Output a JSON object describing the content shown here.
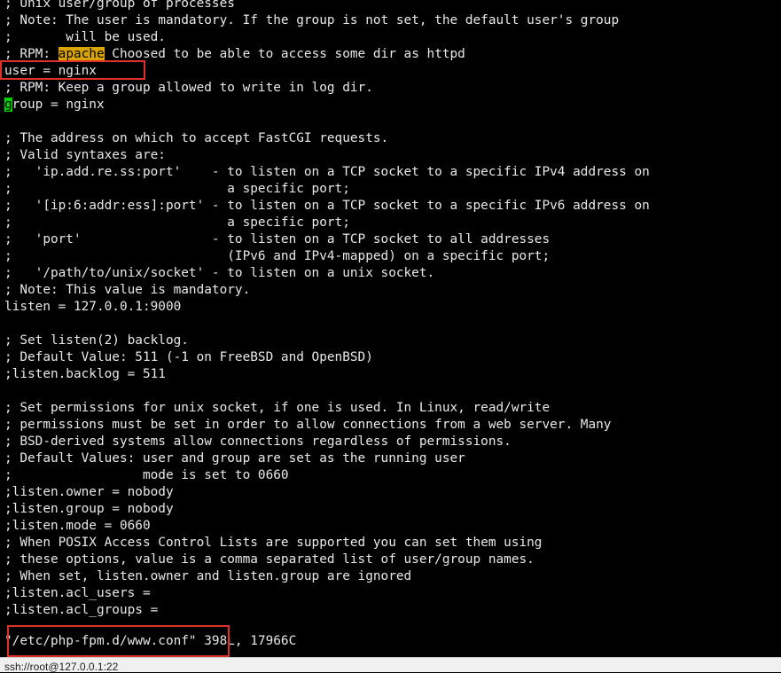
{
  "editor": {
    "lines": [
      "; Unix user/group of processes",
      "; Note: The user is mandatory. If the group is not set, the default user's group",
      ";       will be used.",
      "; RPM: ",
      "user = nginx",
      "; RPM: Keep a group allowed to write in log dir.",
      "roup = nginx",
      "",
      "; The address on which to accept FastCGI requests.",
      "; Valid syntaxes are:",
      ";   'ip.add.re.ss:port'    - to listen on a TCP socket to a specific IPv4 address on",
      ";                            a specific port;",
      ";   '[ip:6:addr:ess]:port' - to listen on a TCP socket to a specific IPv6 address on",
      ";                            a specific port;",
      ";   'port'                 - to listen on a TCP socket to all addresses",
      ";                            (IPv6 and IPv4-mapped) on a specific port;",
      ";   '/path/to/unix/socket' - to listen on a unix socket.",
      "; Note: This value is mandatory.",
      "listen = 127.0.0.1:9000",
      "",
      "; Set listen(2) backlog.",
      "; Default Value: 511 (-1 on FreeBSD and OpenBSD)",
      ";listen.backlog = 511",
      "",
      "; Set permissions for unix socket, if one is used. In Linux, read/write",
      "; permissions must be set in order to allow connections from a web server. Many",
      "; BSD-derived systems allow connections regardless of permissions.",
      "; Default Values: user and group are set as the running user",
      ";                 mode is set to 0660",
      ";listen.owner = nobody",
      ";listen.group = nobody",
      ";listen.mode = 0660",
      "; When POSIX Access Control Lists are supported you can set them using",
      "; these options, value is a comma separated list of user/group names.",
      "; When set, listen.owner and listen.group are ignored",
      ";listen.acl_users =",
      ";listen.acl_groups ="
    ],
    "search_match": "apache",
    "line3_suffix": " Choosed to be able to access some dir as httpd",
    "cursor_char": "g",
    "status_line": "\"/etc/php-fpm.d/www.conf\" 398L, 17966C"
  },
  "tab": {
    "label": "ssh://root@127.0.0.1:22"
  },
  "colors": {
    "background": "#000000",
    "text": "#e8e8e8",
    "search_highlight": "#d9a400",
    "cursor": "#00d000",
    "annotation_box": "#e0302a"
  }
}
